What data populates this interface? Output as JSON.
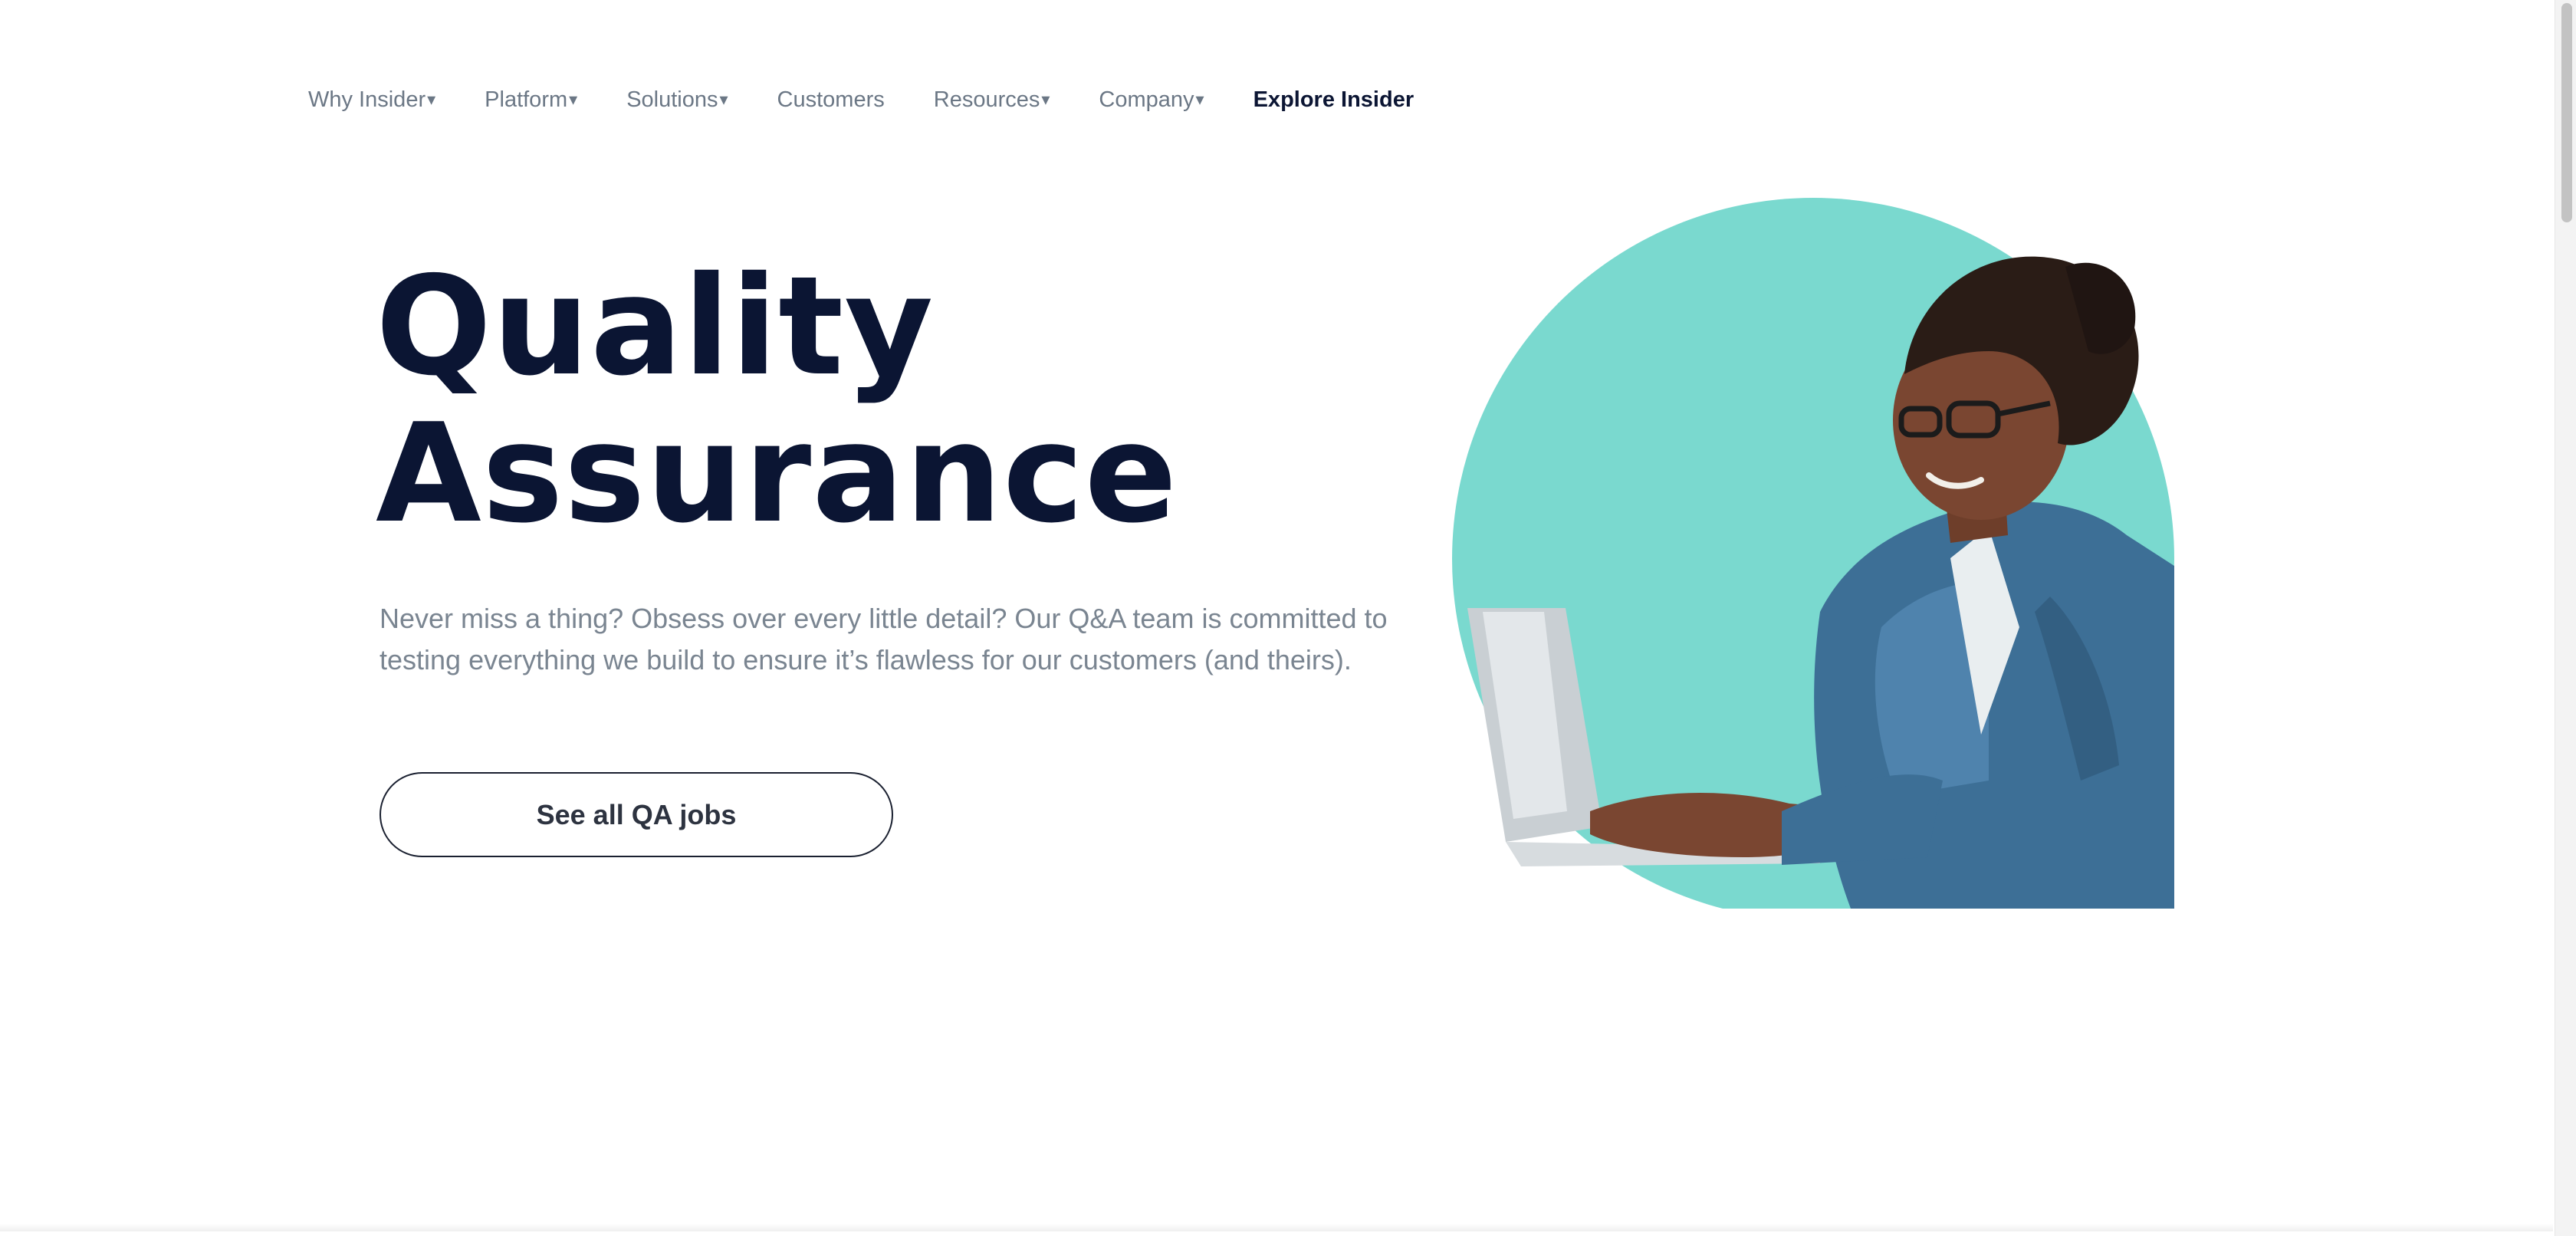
{
  "nav": {
    "items": [
      {
        "label": "Why Insider",
        "caret": "▾"
      },
      {
        "label": "Platform",
        "caret": "▾"
      },
      {
        "label": "Solutions",
        "caret": "▾"
      },
      {
        "label": "Customers",
        "caret": ""
      },
      {
        "label": "Resources",
        "caret": "▾"
      },
      {
        "label": "Company",
        "caret": "▾"
      }
    ],
    "explore_label": "Explore Insider"
  },
  "hero": {
    "title_line1": "Quality",
    "title_line2": "Assurance",
    "description": "Never miss a thing? Obsess over every little detail? Our Q&A team is committed to testing everything we build to ensure it’s flawless for our customers (and theirs).",
    "cta_label": "See all QA jobs"
  },
  "colors": {
    "heading": "#0b1533",
    "nav_text": "#6b7785",
    "body_text": "#7a8591",
    "accent_teal": "#7ad9cf"
  }
}
